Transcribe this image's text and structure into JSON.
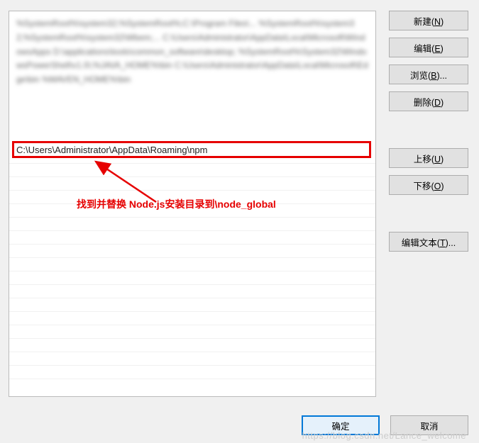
{
  "list": {
    "blurred_placeholder": "%SystemRoot%\\system32;%SystemRoot%;C:\\Program Files\\...\n%SystemRoot%\\system32;%SystemRoot%\\system32\\Wbem;...\nC:\\Users\\Administrator\\AppData\\Local\\Microsoft\\WindowsApps\nD:\\applications\\tools\\common_software\\desktop;\n%SystemRoot%\\System32\\WindowsPowerShell\\v1.0\\;%JAVA_HOME%\\bin\nC:\\Users\\Administrator\\AppData\\Local\\Microsoft\\Edge\\bin\n%MAVEN_HOME%\\bin",
    "highlighted_path": "C:\\Users\\Administrator\\AppData\\Roaming\\npm"
  },
  "annotation": {
    "text": "找到并替换 Node.js安装目录到\\node_global"
  },
  "buttons": {
    "new": {
      "prefix": "新建(",
      "mnemonic": "N",
      "suffix": ")"
    },
    "edit": {
      "prefix": "编辑(",
      "mnemonic": "E",
      "suffix": ")"
    },
    "browse": {
      "prefix": "浏览(",
      "mnemonic": "B",
      "suffix": ")..."
    },
    "delete": {
      "prefix": "删除(",
      "mnemonic": "D",
      "suffix": ")"
    },
    "moveup": {
      "prefix": "上移(",
      "mnemonic": "U",
      "suffix": ")"
    },
    "movedown": {
      "prefix": "下移(",
      "mnemonic": "O",
      "suffix": ")"
    },
    "edittext": {
      "prefix": "编辑文本(",
      "mnemonic": "T",
      "suffix": ")..."
    }
  },
  "footer": {
    "ok": "确定",
    "cancel": "取消"
  },
  "watermark": "https://blog.csdn.net/Lance_welcome"
}
